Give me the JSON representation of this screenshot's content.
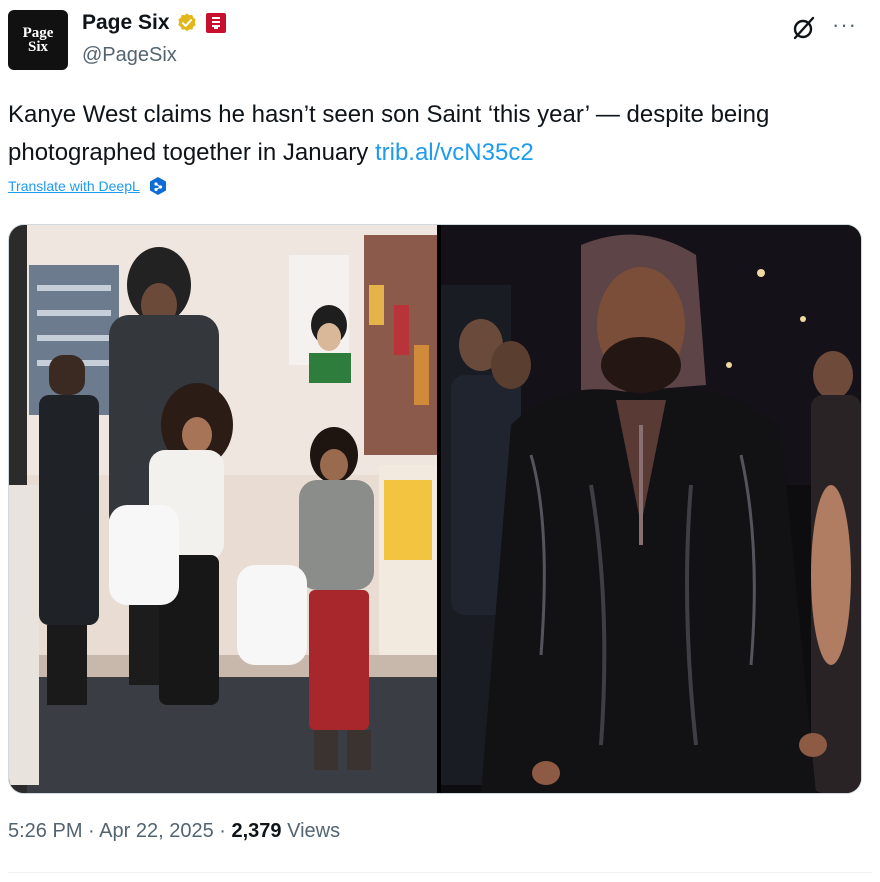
{
  "author": {
    "display_name": "Page Six",
    "handle": "@PageSix",
    "avatar_line1": "Page",
    "avatar_line2": "Six",
    "verified_badge": "gold-check-badge-icon",
    "affiliate_badge": "affiliate-badge-icon"
  },
  "tweet": {
    "text": "Kanye West claims he hasn’t seen son Saint ‘this year’ — despite being photographed together in January",
    "link": "trib.al/vcN35c2",
    "translate_label": "Translate with DeepL"
  },
  "media": {
    "left_photo": "photo-family-store",
    "right_photo": "photo-night-leather-jacket"
  },
  "meta": {
    "time": "5:26 PM",
    "separator1": " · ",
    "date": "Apr 22, 2025",
    "separator2": " · ",
    "views_count": "2,379",
    "views_label": " Views"
  },
  "colors": {
    "link": "#1d9bf0",
    "secondary_text": "#536471",
    "verified_gold": "#e2b719",
    "affiliate_red": "#c8102e"
  }
}
